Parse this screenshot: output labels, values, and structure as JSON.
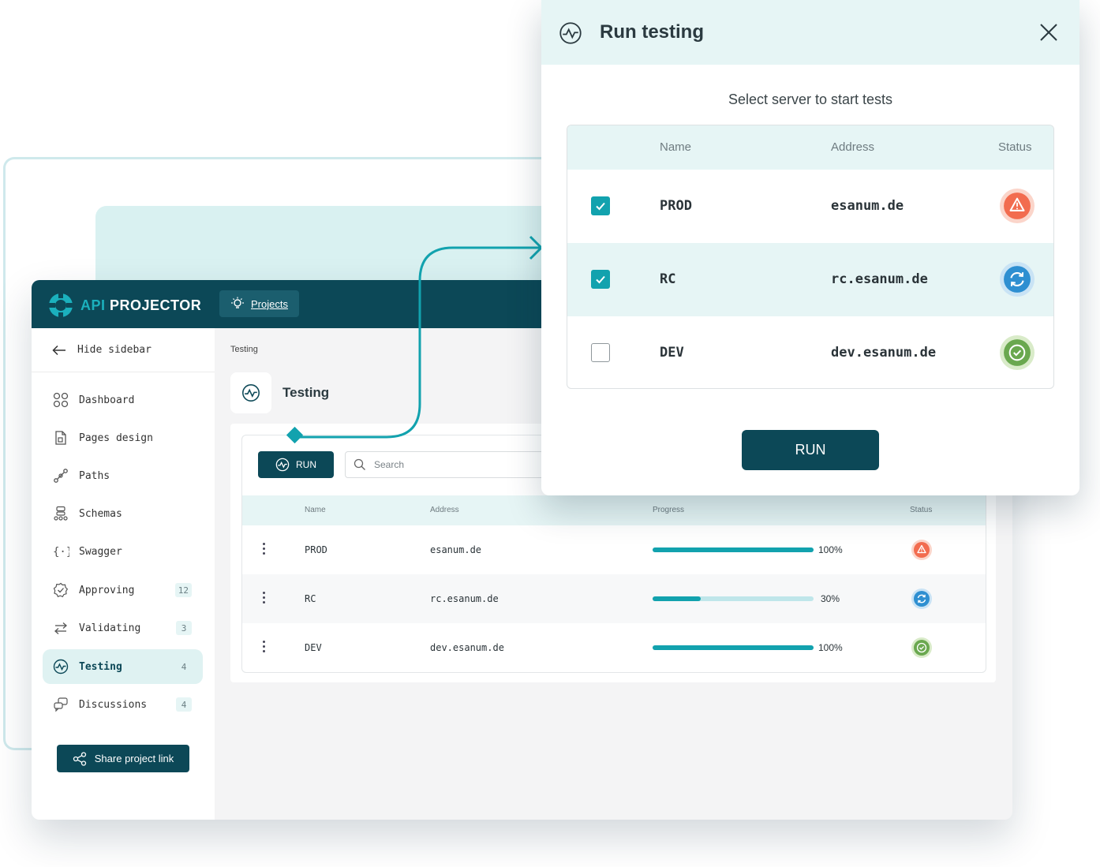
{
  "app": {
    "logo_api": "API",
    "logo_rest": " PROJECTOR",
    "projects_label": "Projects"
  },
  "sidebar": {
    "hide_label": "Hide sidebar",
    "items": [
      {
        "label": "Dashboard",
        "icon": "dashboard-icon",
        "badge": ""
      },
      {
        "label": "Pages design",
        "icon": "pages-design-icon",
        "badge": ""
      },
      {
        "label": "Paths",
        "icon": "paths-icon",
        "badge": ""
      },
      {
        "label": "Schemas",
        "icon": "schemas-icon",
        "badge": ""
      },
      {
        "label": "Swagger",
        "icon": "swagger-icon",
        "badge": ""
      },
      {
        "label": "Approving",
        "icon": "approving-icon",
        "badge": "12"
      },
      {
        "label": "Validating",
        "icon": "validating-icon",
        "badge": "3"
      },
      {
        "label": "Testing",
        "icon": "testing-icon",
        "badge": "4",
        "active": true
      },
      {
        "label": "Discussions",
        "icon": "discussions-icon",
        "badge": "4"
      }
    ],
    "share_label": "Share project link"
  },
  "page": {
    "breadcrumb": "Testing",
    "title": "Testing",
    "run_label": "RUN",
    "search_placeholder": "Search"
  },
  "table": {
    "headers": {
      "name": "Name",
      "address": "Address",
      "progress": "Progress",
      "status": "Status"
    },
    "rows": [
      {
        "name": "PROD",
        "address": "esanum.de",
        "progress": 100,
        "progress_label": "100%",
        "status": "warning"
      },
      {
        "name": "RC",
        "address": "rc.esanum.de",
        "progress": 30,
        "progress_label": "30%",
        "status": "syncing"
      },
      {
        "name": "DEV",
        "address": "dev.esanum.de",
        "progress": 100,
        "progress_label": "100%",
        "status": "success"
      }
    ]
  },
  "modal": {
    "title": "Run testing",
    "subtitle": "Select server to start tests",
    "headers": {
      "name": "Name",
      "address": "Address",
      "status": "Status"
    },
    "rows": [
      {
        "name": "PROD",
        "address": "esanum.de",
        "checked": true,
        "status": "warning"
      },
      {
        "name": "RC",
        "address": "rc.esanum.de",
        "checked": true,
        "status": "syncing"
      },
      {
        "name": "DEV",
        "address": "dev.esanum.de",
        "checked": false,
        "status": "success"
      }
    ],
    "run_label": "RUN"
  },
  "colors": {
    "primary": "#0c4857",
    "accent": "#12a2ae",
    "light_teal": "#e6f5f5",
    "warning": "#f26c4f",
    "syncing": "#2e8fd1",
    "success": "#6aa84f"
  }
}
